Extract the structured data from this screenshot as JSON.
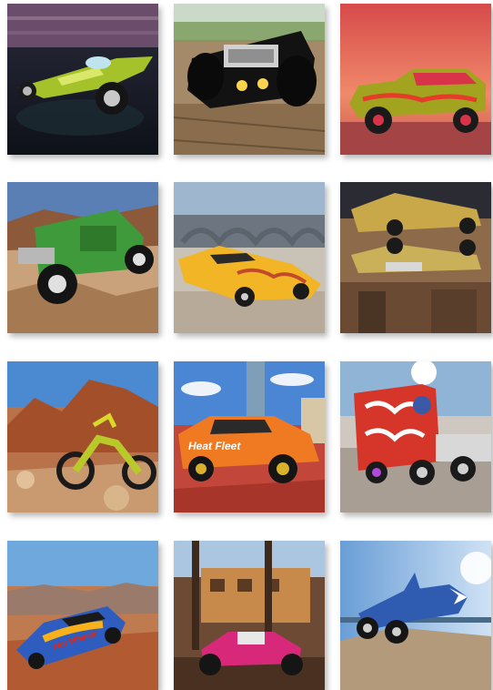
{
  "gallery": {
    "tiles": [
      {
        "id": "green-hotrod-water"
      },
      {
        "id": "black-rod-boards"
      },
      {
        "id": "gold-gasser-sunset"
      },
      {
        "id": "green-bonebreaker-rocks"
      },
      {
        "id": "yellow-flame-vette-bridge"
      },
      {
        "id": "gold-cars-stacked-town"
      },
      {
        "id": "motocross-desert"
      },
      {
        "id": "orange-gasser-city"
      },
      {
        "id": "semi-truck-flames"
      },
      {
        "id": "blue-rally-car-desert"
      },
      {
        "id": "pink-rod-western"
      },
      {
        "id": "shark-car-beach"
      }
    ],
    "decals": {
      "heat_fleet": "Heat Fleet",
      "hot_wheels": "Hot Wheels"
    }
  }
}
